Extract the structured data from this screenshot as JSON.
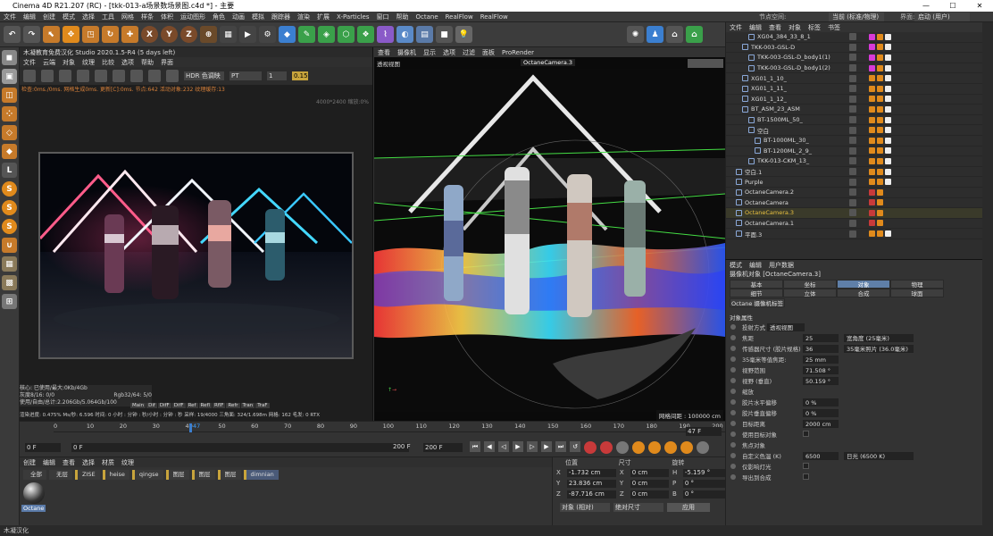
{
  "app": {
    "title": "Cinema 4D R21.207 (RC) - [tkk-013-a场景数场景图.c4d *] - 主要"
  },
  "menus": [
    "文件",
    "编辑",
    "创建",
    "模式",
    "选择",
    "工具",
    "网格",
    "样条",
    "体积",
    "运动图形",
    "角色",
    "动画",
    "模拟",
    "跟踪器",
    "渲染",
    "扩展",
    "X-Particles",
    "窗口",
    "帮助",
    "Octane",
    "RealFlow",
    "RealFlow"
  ],
  "menu_right": {
    "node_space_label": "节点空间:",
    "node_space_value": "当前 (标准/物理)",
    "layout_label": "界面:",
    "layout_value": "启动 (用户)"
  },
  "render_view": {
    "window_title": "木凝教育免费汉化 Studio 2020.1.5-R4 (5 days left)",
    "menu": [
      "文件",
      "云端",
      "对象",
      "纹理",
      "比较",
      "选项",
      "帮助",
      "界面"
    ],
    "tonemap": "HDR 色调映",
    "pt": "PT",
    "num": "1",
    "zoom": "0.15",
    "status_line": "检查:0ms./0ms. 网格生成0ms. 更新[C]:0ms. 节点:642 活动对象:232 纹理缓存:13",
    "res": "4000*2400 缩放:0%",
    "stats": [
      "核心: 已使用/最大:0Kb/4Gb",
      "灰度8/16: 0/0",
      "Rgb32/64: 5/0",
      "使用/自由/总计:2.206Gb/5.064Gb/100"
    ],
    "bottom": "渲染进度: 0.475% Ms/秒: 6.596 时间: 0 小时 : 分钟 : 秒/小时 : 分钟 : 秒 采样: 19/4000 三角面: 324/1.698m 网格: 162 毛发: 0 RTX",
    "passes": [
      "Main",
      "Dif",
      "DifF",
      "DifF",
      "Ref",
      "Refl",
      "RflF",
      "Refr",
      "Tran",
      "TraF"
    ]
  },
  "viewport": {
    "menu": [
      "查看",
      "摄像机",
      "显示",
      "选项",
      "过滤",
      "面板",
      "ProRender"
    ],
    "label": "透视视图",
    "camera": "OctaneCamera.3",
    "grid": "网格间距 : 100000 cm"
  },
  "timeline": {
    "ticks": [
      "0",
      "10",
      "20",
      "30",
      "40",
      "50",
      "60",
      "70",
      "80",
      "90",
      "100",
      "110",
      "120",
      "130",
      "140",
      "150",
      "160",
      "170",
      "180",
      "190",
      "200"
    ],
    "current_frame": "47",
    "start": "0 F",
    "start2": "0 F",
    "end": "200 F",
    "end2": "200 F",
    "frame_field": "47 F"
  },
  "materials": {
    "menu": [
      "创建",
      "编辑",
      "查看",
      "选择",
      "材质",
      "纹理"
    ],
    "tabs": [
      "全部",
      "无层",
      "ZISE",
      "heise",
      "qingse",
      "图层",
      "图层",
      "图层",
      "dimnian"
    ],
    "items": [
      {
        "name": "Octane"
      }
    ]
  },
  "coordinates": {
    "headers": [
      "位置",
      "尺寸",
      "旋转"
    ],
    "rows": [
      {
        "axis": "X",
        "pos": "-1.732 cm",
        "size": "0 cm",
        "rot_axis": "H",
        "rot": "-5.159 °"
      },
      {
        "axis": "Y",
        "pos": "23.836 cm",
        "size": "0 cm",
        "rot_axis": "P",
        "rot": "0 °"
      },
      {
        "axis": "Z",
        "pos": "-87.716 cm",
        "size": "0 cm",
        "rot_axis": "B",
        "rot": "0 °"
      }
    ],
    "mode": "对象 (相对)",
    "size_mode": "绝对尺寸",
    "apply": "应用"
  },
  "object_manager": {
    "menu": [
      "文件",
      "编辑",
      "查看",
      "对象",
      "标签",
      "书签"
    ],
    "rows": [
      {
        "name": "XG04_384_33_8_1",
        "indent": 3
      },
      {
        "name": "TKK-003-GSL-D",
        "indent": 2
      },
      {
        "name": "TKK-003-GSL-D_body1(1)",
        "indent": 3
      },
      {
        "name": "TKK-003-GSL-D_body1(2)",
        "indent": 3
      },
      {
        "name": "XG01_1_10_",
        "indent": 2
      },
      {
        "name": "XG01_1_11_",
        "indent": 2
      },
      {
        "name": "XG01_1_12_",
        "indent": 2
      },
      {
        "name": "BT_ASM_23_ASM",
        "indent": 2
      },
      {
        "name": "BT-1500ML_50_",
        "indent": 3
      },
      {
        "name": "空白",
        "indent": 3
      },
      {
        "name": "BT-1000ML_30_",
        "indent": 4
      },
      {
        "name": "BT-1200ML_2_9_",
        "indent": 4
      },
      {
        "name": "TKK-013-CKM_13_",
        "indent": 3
      },
      {
        "name": "空白.1",
        "indent": 1
      },
      {
        "name": "Purple",
        "indent": 1
      },
      {
        "name": "OctaneCamera.2",
        "indent": 1
      },
      {
        "name": "OctaneCamera",
        "indent": 1
      },
      {
        "name": "OctaneCamera.3",
        "indent": 1,
        "active": true
      },
      {
        "name": "OctaneCamera.1",
        "indent": 1
      },
      {
        "name": "平面.3",
        "indent": 1
      }
    ]
  },
  "attributes": {
    "menu": [
      "模式",
      "编辑",
      "用户数据"
    ],
    "title": "摄像机对象 [OctaneCamera.3]",
    "tabs1": [
      "基本",
      "坐标",
      "对象",
      "物理"
    ],
    "tabs2": [
      "细节",
      "立体",
      "合成",
      "球面"
    ],
    "tag": "Octane 摄像机标签",
    "section": "对象属性",
    "projection_label": "投射方式",
    "projection_value": "透视视图",
    "fields": [
      {
        "label": "焦距",
        "value": "25",
        "extra": "宽角度 (25毫米)"
      },
      {
        "label": "传感器尺寸 (胶片规格)",
        "value": "36",
        "extra": "35毫米照片 (36.0毫米)"
      },
      {
        "label": "35毫米等值焦距:",
        "value": "25 mm",
        "extra": ""
      },
      {
        "label": "视野范围",
        "value": "71.508 °",
        "extra": ""
      },
      {
        "label": "视野 (垂直)",
        "value": "50.159 °",
        "extra": ""
      },
      {
        "label": "缩放",
        "value": "",
        "extra": ""
      },
      {
        "label": "胶片水平偏移",
        "value": "0 %",
        "extra": ""
      },
      {
        "label": "胶片垂直偏移",
        "value": "0 %",
        "extra": ""
      },
      {
        "label": "目标距离",
        "value": "2000 cm",
        "extra": ""
      },
      {
        "label": "使用目标对象",
        "value": "",
        "extra": ""
      },
      {
        "label": "焦点对象",
        "value": "",
        "extra": ""
      },
      {
        "label": "自定义色温 (K)",
        "value": "6500",
        "extra": "日光 (6500 K)"
      },
      {
        "label": "仅影响灯光",
        "value": "",
        "extra": ""
      },
      {
        "label": "导出到合成",
        "value": "",
        "extra": ""
      }
    ]
  },
  "status": "木凝汉化"
}
